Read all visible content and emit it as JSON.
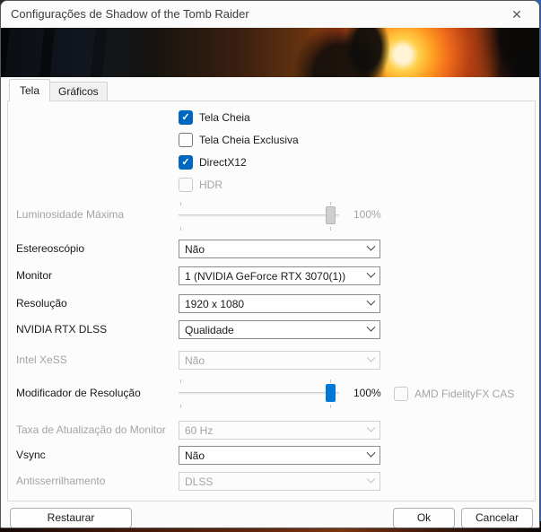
{
  "window": {
    "title": "Configurações de Shadow of the Tomb Raider"
  },
  "icons": {
    "close": "✕",
    "check": "✓",
    "chevron_down": "chevron-down"
  },
  "tabs": [
    {
      "label": "Tela",
      "active": true
    },
    {
      "label": "Gráficos",
      "active": false
    }
  ],
  "checkboxes": [
    {
      "label": "Tela Cheia",
      "checked": true,
      "disabled": false
    },
    {
      "label": "Tela Cheia Exclusiva",
      "checked": false,
      "disabled": false
    },
    {
      "label": "DirectX12",
      "checked": true,
      "disabled": false
    },
    {
      "label": "HDR",
      "checked": false,
      "disabled": true
    }
  ],
  "sliders": [
    {
      "label": "Luminosidade Máxima",
      "value": 100,
      "value_label": "100%",
      "disabled": true
    },
    {
      "label": "Modificador de Resolução",
      "value": 100,
      "value_label": "100%",
      "disabled": false
    }
  ],
  "amd_checkbox": {
    "label": "AMD FidelityFX CAS",
    "checked": false,
    "disabled": true
  },
  "dropdowns": [
    {
      "label": "Estereoscópio",
      "value": "Não",
      "disabled": false
    },
    {
      "label": "Monitor",
      "value": "1 (NVIDIA GeForce RTX 3070(1))",
      "disabled": false
    },
    {
      "label": "Resolução",
      "value": "1920 x 1080",
      "disabled": false
    },
    {
      "label": "NVIDIA RTX DLSS",
      "value": "Qualidade",
      "disabled": false
    },
    {
      "label": "Intel XeSS",
      "value": "Não",
      "disabled": true
    },
    {
      "label": "Taxa de Atualização do Monitor",
      "value": "60 Hz",
      "disabled": true
    },
    {
      "label": "Vsync",
      "value": "Não",
      "disabled": false
    },
    {
      "label": "Antisserrilhamento",
      "value": "DLSS",
      "disabled": true
    }
  ],
  "buttons": {
    "restore": "Restaurar",
    "ok": "Ok",
    "cancel": "Cancelar"
  },
  "colors": {
    "accent_checkbox": "#0067c0",
    "accent_slider": "#0078d7",
    "disabled_text": "#a4a4a4"
  }
}
